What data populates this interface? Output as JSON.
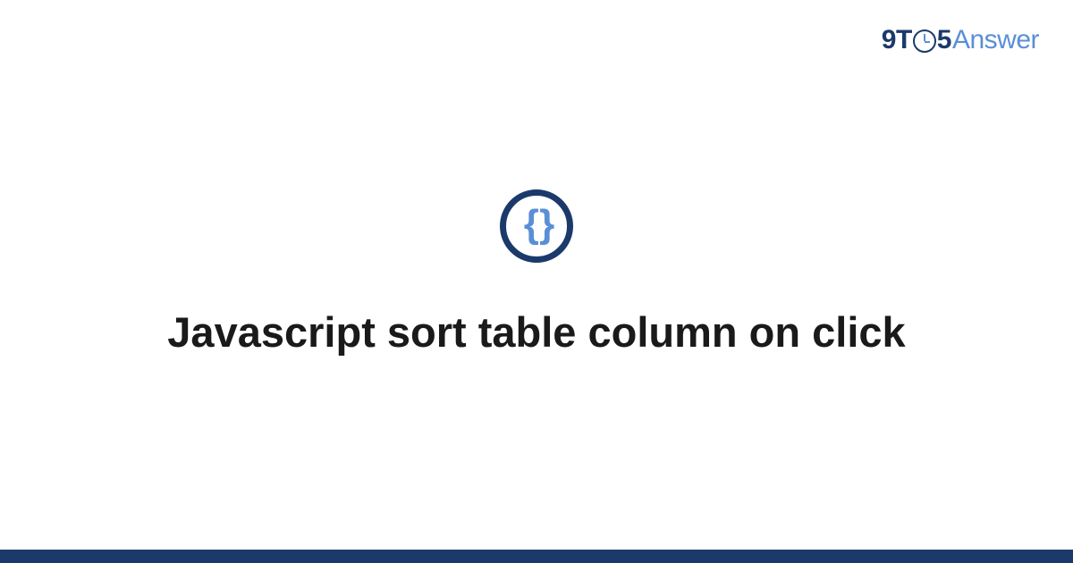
{
  "brand": {
    "nine": "9",
    "t": "T",
    "five": "5",
    "answer": "Answer"
  },
  "category_icon": {
    "name": "code-braces-icon",
    "glyph": "{ }"
  },
  "title": "Javascript sort table column on click",
  "colors": {
    "primary_dark": "#1b3a6b",
    "primary_light": "#5a8fd6",
    "text": "#1a1a1a"
  }
}
